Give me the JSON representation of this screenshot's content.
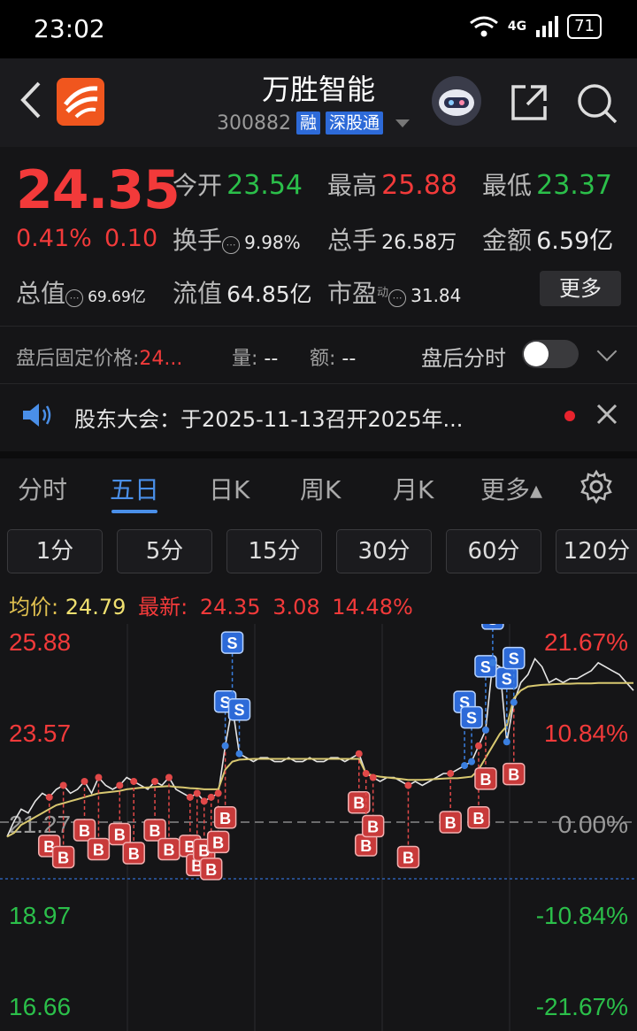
{
  "status_bar": {
    "time": "23:02",
    "network": "4G",
    "battery": "71"
  },
  "header": {
    "title": "万胜智能",
    "code": "300882",
    "tags": [
      "融",
      "深股通"
    ]
  },
  "quote": {
    "price": "24.35",
    "change_pct": "0.41%",
    "change": "0.10",
    "open_label": "今开",
    "open": "23.54",
    "high_label": "最高",
    "high": "25.88",
    "low_label": "最低",
    "low": "23.37",
    "turnover_label": "换手",
    "turnover": "9.98%",
    "volume_label": "总手",
    "volume": "26.58万",
    "amount_label": "金额",
    "amount": "6.59亿",
    "mktcap_label": "总值",
    "mktcap": "69.69亿",
    "float_label": "流值",
    "float": "64.85亿",
    "pe_label": "市盈",
    "pe_sup": "动",
    "pe": "31.84",
    "more_label": "更多"
  },
  "after_hours": {
    "fixed_price_label": "盘后固定价格:",
    "fixed_price": "24...",
    "vol_label": "量:",
    "vol": "--",
    "amt_label": "额:",
    "amt": "--",
    "intraday_label": "盘后分时"
  },
  "notice": {
    "text": "股东大会：于2025-11-13召开2025年..."
  },
  "tabs": [
    "分时",
    "五日",
    "日K",
    "周K",
    "月K",
    "更多▴"
  ],
  "active_tab": "五日",
  "periods": [
    "1分",
    "5分",
    "15分",
    "30分",
    "60分",
    "120分"
  ],
  "avg": {
    "avg_label": "均价:",
    "avg_value": "24.79",
    "latest_label": "最新:",
    "latest_value": "24.35",
    "latest_change": "3.08",
    "latest_pct": "14.48%"
  },
  "colors": {
    "up": "#f23a3a",
    "down": "#2bbf4a",
    "accent": "#4a8fe8",
    "avg_line": "#d8c870"
  },
  "chart_data": {
    "type": "line",
    "y_range": [
      16.66,
      25.88
    ],
    "y_ticks_left": [
      "25.88",
      "23.57",
      "21.27",
      "18.97",
      "16.66"
    ],
    "y_ticks_right": [
      "21.67%",
      "10.84%",
      "0.00%",
      "-10.84%",
      "-21.67%"
    ],
    "days": 5,
    "series": [
      {
        "values": [
          20.9,
          21.3,
          21.6,
          21.5,
          21.8,
          22.0,
          21.9,
          22.1,
          22.2,
          22.0,
          22.1,
          22.3,
          22.0,
          22.4,
          22.2,
          22.1,
          22.2,
          22.4,
          22.3,
          22.2,
          22.1,
          22.3,
          22.2,
          22.4,
          22.1,
          22.0,
          21.9,
          22.0,
          21.8,
          21.9,
          22.0,
          23.2,
          24.2,
          23.0,
          22.9,
          22.8,
          22.9,
          22.9,
          22.8,
          22.8,
          22.9,
          22.8,
          22.8,
          22.9,
          22.8,
          22.8,
          22.9,
          22.9,
          22.8,
          22.9,
          23.0,
          22.5,
          22.4,
          22.3,
          22.4,
          22.4,
          22.3,
          22.2,
          22.3,
          22.2,
          22.3,
          22.4,
          22.5,
          22.5,
          22.6,
          22.7,
          22.8,
          23.2,
          23.6,
          25.3,
          25.2,
          23.3,
          24.3,
          24.8,
          25.0,
          25.4,
          25.2,
          24.8,
          24.9,
          24.8,
          24.9,
          24.9,
          25.0,
          25.1,
          25.3,
          25.2,
          25.1,
          25.0,
          24.8,
          24.6
        ]
      },
      {
        "values": [
          20.9,
          21.0,
          21.2,
          21.3,
          21.4,
          21.5,
          21.6,
          21.7,
          21.75,
          21.8,
          21.85,
          21.9,
          21.95,
          22.0,
          22.02,
          22.04,
          22.06,
          22.1,
          22.12,
          22.14,
          22.15,
          22.16,
          22.17,
          22.18,
          22.16,
          22.15,
          22.13,
          22.12,
          22.1,
          22.1,
          22.1,
          22.6,
          22.8,
          22.85,
          22.86,
          22.87,
          22.87,
          22.87,
          22.87,
          22.87,
          22.87,
          22.87,
          22.87,
          22.87,
          22.87,
          22.87,
          22.87,
          22.87,
          22.87,
          22.87,
          22.87,
          22.5,
          22.45,
          22.42,
          22.4,
          22.38,
          22.36,
          22.34,
          22.34,
          22.34,
          22.35,
          22.36,
          22.37,
          22.38,
          22.38,
          22.4,
          22.42,
          22.6,
          22.9,
          23.2,
          23.5,
          23.7,
          24.4,
          24.6,
          24.7,
          24.72,
          24.74,
          24.75,
          24.76,
          24.77,
          24.77,
          24.78,
          24.78,
          24.78,
          24.79,
          24.79,
          24.79,
          24.79,
          24.79,
          24.79
        ]
      }
    ],
    "buy_markers": [
      6,
      8,
      11,
      13,
      16,
      18,
      21,
      23,
      26,
      27,
      28,
      29,
      30,
      31,
      50,
      51,
      52,
      57,
      63,
      67,
      68,
      72
    ],
    "sell_markers": [
      31,
      32,
      33,
      65,
      66,
      68,
      69,
      71,
      72
    ]
  }
}
